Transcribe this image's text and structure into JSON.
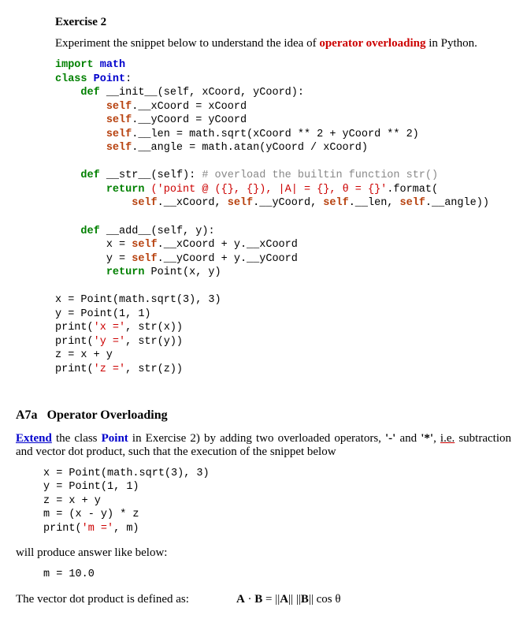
{
  "exercise": {
    "title": "Exercise 2",
    "intro_prefix": "Experiment the snippet below to understand the idea of ",
    "intro_highlight": "operator overloading",
    "intro_suffix": " in Python."
  },
  "code1": {
    "kw_import": "import",
    "mod_math": "math",
    "kw_class": "class",
    "cls_point": "Point",
    "colon": ":",
    "kw_def": "def",
    "init_sig": "__init__(self, xCoord, yCoord):",
    "kw_self": "self",
    "init_l1": ".__xCoord = xCoord",
    "init_l2": ".__yCoord = yCoord",
    "init_l3": ".__len = math.sqrt(xCoord ** 2 + yCoord ** 2)",
    "init_l4": ".__angle = math.atan(yCoord / xCoord)",
    "str_sig": "__str__(self):",
    "str_comment": " # overload the builtin function str()",
    "kw_return": "return",
    "str_ret_str": " ('point @ ({}, {}), |A| = {}, θ = {}'",
    "str_fmt": ".format(",
    "str_args_p1": ".__xCoord, ",
    "str_args_p2": ".__yCoord, ",
    "str_args_p3": ".__len, ",
    "str_args_p4": ".__angle))",
    "add_sig": "__add__(self, y):",
    "add_l1a": "x = ",
    "add_l1b": ".__xCoord + y.__xCoord",
    "add_l2a": "y = ",
    "add_l2b": ".__yCoord + y.__yCoord",
    "add_ret": " Point(x, y)",
    "main_l1": "x = Point(math.sqrt(3), 3)",
    "main_l2": "y = Point(1, 1)",
    "main_l3a": "print(",
    "main_l3s": "'x ='",
    "main_l3b": ", str(x))",
    "main_l4a": "print(",
    "main_l4s": "'y ='",
    "main_l4b": ", str(y))",
    "main_l5": "z = x + y",
    "main_l6a": "print(",
    "main_l6s": "'z ='",
    "main_l6b": ", str(z))"
  },
  "section": {
    "label": "A7a",
    "title": "Operator Overloading"
  },
  "part2": {
    "extend": "Extend",
    "p1_a": " the class ",
    "p1_point": "Point",
    "p1_b": " in Exercise 2) by adding two overloaded operators, ",
    "op_sub": "'-'",
    "p1_c": " and ",
    "op_mul": "'*'",
    "p1_d": ", ",
    "ie": "i.e.",
    "p1_e": " subtraction and vector dot product, such that the execution of the snippet below"
  },
  "code2": {
    "l1": "x = Point(math.sqrt(3), 3)",
    "l2": "y = Point(1, 1)",
    "l3": "z = x + y",
    "l4": "m = (x - y) * z",
    "l5a": "print(",
    "l5s": "'m ='",
    "l5b": ", m)"
  },
  "output": {
    "intro": "will produce answer like below:",
    "line": "m = 10.0"
  },
  "vector": {
    "text": "The vector dot product is defined as:",
    "formula": "A · B = ||A|| ||B|| cos θ"
  }
}
